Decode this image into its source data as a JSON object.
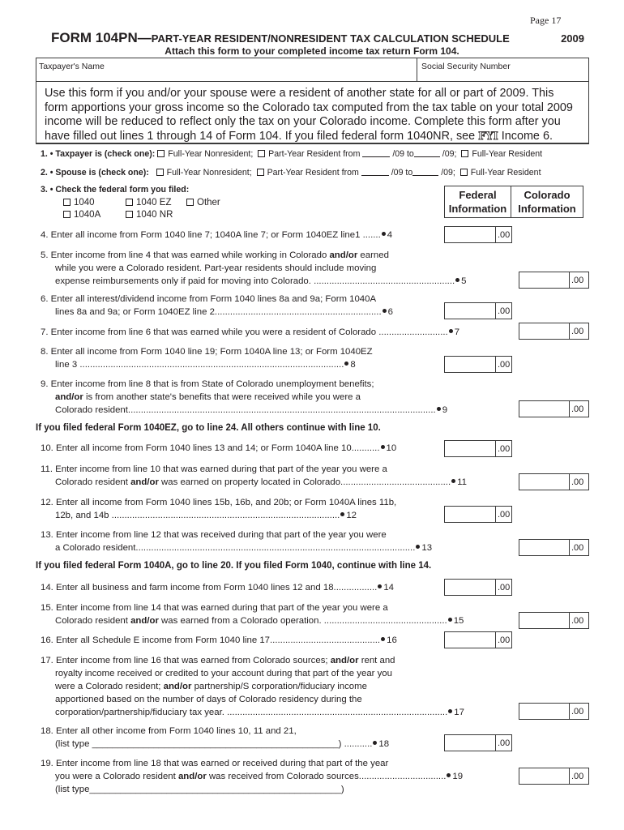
{
  "page": {
    "label": "Page 17"
  },
  "header": {
    "form_id": "FORM 104PN—",
    "form_subtitle": "PART-YEAR RESIDENT/NONRESIDENT TAX CALCULATION SCHEDULE",
    "year": "2009",
    "attach_note": "Attach this form to your completed income tax return Form 104."
  },
  "identity": {
    "taxpayer_name_label": "Taxpayer's Name",
    "taxpayer_name_value": "",
    "ssn_label": "Social Security Number",
    "ssn_value": ""
  },
  "instructions": {
    "text_before_fyi": "Use this form if you and/or your spouse were a resident of another state for all or part of 2009. This form apportions your gross income so the Colorado tax computed from the tax table on your total 2009 income will be reduced to reflect only the tax on your Colorado income. Complete this form after you have filled out lines 1 through 14 of Form 104. If you filed federal form 1040NR, see ",
    "fyi_label": "FYI",
    "text_after_fyi": " Income 6."
  },
  "residency": {
    "taxpayer": {
      "label": "1. • Taxpayer is (check one):",
      "options": [
        "Full-Year Nonresident;",
        "Part-Year Resident from",
        "Full-Year Resident"
      ],
      "from_suffix": "/09  to",
      "to_suffix": "/09;",
      "checked": null
    },
    "spouse": {
      "label": "2. • Spouse is (check one):",
      "options": [
        "Full-Year Nonresident;",
        "Part-Year Resident from",
        "Full-Year Resident"
      ],
      "from_suffix": "/09  to",
      "to_suffix": "/09;",
      "checked": null
    }
  },
  "federal_form": {
    "label": "3. • Check the federal form you filed:",
    "options": [
      "1040",
      "1040 EZ",
      "Other",
      "1040A",
      "1040 NR"
    ],
    "checked": null
  },
  "columns": {
    "federal": [
      "Federal",
      "Information"
    ],
    "colorado": [
      "Colorado",
      "Information"
    ]
  },
  "lines": [
    {
      "num": "4",
      "text": [
        "4.  Enter all income from Form 1040 line 7; 1040A line 7; or Form 1040EZ line1 ......."
      ],
      "column": "federal",
      "cents": ".00",
      "value": ""
    },
    {
      "num": "5",
      "text": [
        "5.  Enter income from line 4 that was earned while working in Colorado |and/or| earned",
        "while you were a Colorado resident. Part-year residents should include moving",
        "expense reimbursements only if paid for moving into Colorado. ......................................................."
      ],
      "column": "colorado",
      "cents": ".00",
      "value": ""
    },
    {
      "num": "6",
      "text": [
        "6.  Enter all interest/dividend income from Form 1040 lines 8a and 9a; Form 1040A",
        "lines 8a and 9a; or Form 1040EZ line 2................................................................."
      ],
      "column": "federal",
      "cents": ".00",
      "value": ""
    },
    {
      "num": "7",
      "text": [
        "7.  Enter income from line 6 that was earned while you were a resident of Colorado ..........................."
      ],
      "column": "colorado",
      "cents": ".00",
      "value": ""
    },
    {
      "num": "8",
      "text": [
        "8.  Enter all income from Form 1040 line 19; Form 1040A line 13; or Form 1040EZ",
        "line 3 ......................................................................................................."
      ],
      "column": "federal",
      "cents": ".00",
      "value": ""
    },
    {
      "num": "9",
      "text": [
        "9.  Enter income from line 8 that is from State of Colorado unemployment benefits;",
        "|and/or| is from another state's benefits that were received while you were a",
        "Colorado resident........................................................................................................................"
      ],
      "column": "colorado",
      "cents": ".00",
      "value": ""
    },
    {
      "num": "10",
      "text": [
        "10. Enter all income from Form 1040 lines 13 and 14; or Form 1040A line 10..........."
      ],
      "column": "federal",
      "cents": ".00",
      "value": ""
    },
    {
      "num": "11",
      "text": [
        "11. Enter income from line 10 that was earned during that part of the year you were a",
        "Colorado resident |and/or| was earned on property located in Colorado..........................................."
      ],
      "column": "colorado",
      "cents": ".00",
      "value": ""
    },
    {
      "num": "12",
      "text": [
        "12. Enter all income from Form 1040 lines 15b, 16b, and 20b; or Form 1040A lines 11b,",
        "12b, and 14b ........................................................................................."
      ],
      "column": "federal",
      "cents": ".00",
      "value": ""
    },
    {
      "num": "13",
      "text": [
        "13. Enter income from line 12 that was received during that part of the year you were",
        "a Colorado resident............................................................................................................."
      ],
      "column": "colorado",
      "cents": ".00",
      "value": ""
    },
    {
      "num": "14",
      "text": [
        "14. Enter all business and farm income from Form 1040 lines 12 and 18................."
      ],
      "column": "federal",
      "cents": ".00",
      "value": ""
    },
    {
      "num": "15",
      "text": [
        "15. Enter income from line 14 that was earned during that part of the year you were a",
        "Colorado resident |and/or| was earned from a Colorado operation. ................................................"
      ],
      "column": "colorado",
      "cents": ".00",
      "value": ""
    },
    {
      "num": "16",
      "text": [
        "16. Enter all Schedule E income from Form 1040 line 17..........................................."
      ],
      "column": "federal",
      "cents": ".00",
      "value": ""
    },
    {
      "num": "17",
      "text": [
        "17. Enter income from line 16 that was earned from Colorado sources; |and/or| rent and",
        "royalty income received or credited to your account during that part of the year you",
        "were a Colorado resident; |and/or| partnership/S corporation/fiduciary income",
        "apportioned based on the number of days of Colorado residency during the",
        "corporation/partnership/fiduciary tax year. ......................................................................................"
      ],
      "column": "colorado",
      "cents": ".00",
      "value": ""
    },
    {
      "num": "18",
      "text": [
        "18. Enter all other income from Form 1040 lines 10, 11 and 21,",
        "(list type ________________________________________________) ..........."
      ],
      "column": "federal",
      "cents": ".00",
      "value": "",
      "list_type": ""
    },
    {
      "num": "19",
      "text": [
        "19. Enter income from line 18 that was earned or received during that part of the year",
        "you were a Colorado resident |and/or| was received from Colorado sources..................................",
        "(list type_________________________________________________)"
      ],
      "column": "colorado",
      "cents": ".00",
      "value": "",
      "list_type": ""
    }
  ],
  "notes": {
    "after_line_9": "If you filed federal Form 1040EZ, go to line 24. All others continue with line 10.",
    "after_line_13": "If you filed federal Form 1040A, go to line 20. If you filed Form 1040, continue with line 14."
  }
}
